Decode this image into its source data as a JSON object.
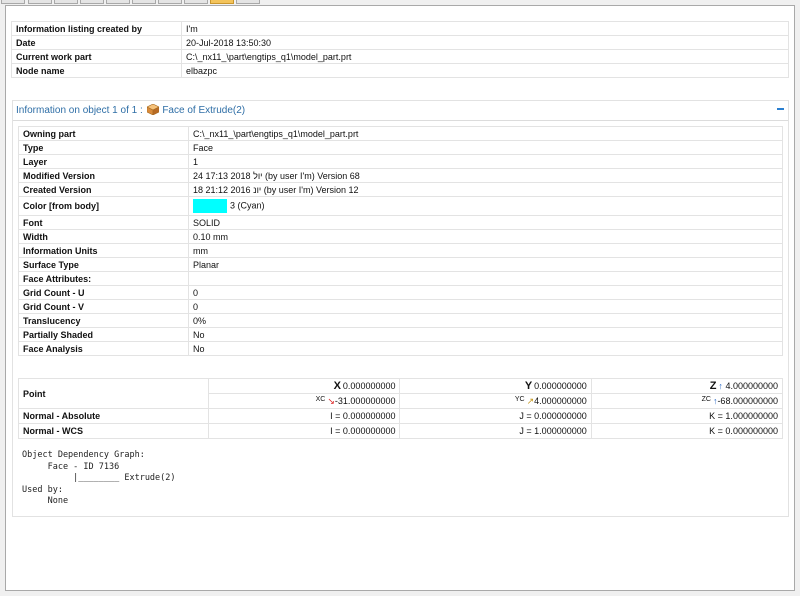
{
  "header": {
    "rows": [
      {
        "label": "Information listing created by",
        "value": "I'm"
      },
      {
        "label": "Date",
        "value": "20-Jul-2018 13:50:30"
      },
      {
        "label": "Current work part",
        "value": "C:\\_nx11_\\part\\engtips_q1\\model_part.prt"
      },
      {
        "label": "Node name",
        "value": "elbazpc"
      }
    ]
  },
  "section": {
    "title_prefix": "Information on object 1 of 1 :",
    "title_object": "Face of Extrude(2)",
    "collapse_icon": "minus-icon"
  },
  "properties": [
    {
      "label": "Owning part",
      "value": "C:\\_nx11_\\part\\engtips_q1\\model_part.prt"
    },
    {
      "label": "Type",
      "value": "Face"
    },
    {
      "label": "Layer",
      "value": "1"
    },
    {
      "label": "Modified Version",
      "value": "24 17:13 2018 יול (by user I'm) Version 68"
    },
    {
      "label": "Created Version",
      "value": "18 21:12 2016 יונ (by user I'm) Version 12"
    },
    {
      "label": "Color [from body]",
      "value": "3 (Cyan)",
      "swatch": "#00ffff"
    },
    {
      "label": "Font",
      "value": "SOLID"
    },
    {
      "label": "Width",
      "value": "0.10 mm"
    },
    {
      "label": "Information Units",
      "value": "mm"
    },
    {
      "label": "Surface Type",
      "value": "Planar"
    },
    {
      "label": "Face Attributes:",
      "value": ""
    },
    {
      "label": "Grid Count - U",
      "value": "0"
    },
    {
      "label": "Grid Count - V",
      "value": "0"
    },
    {
      "label": "Translucency",
      "value": "0%"
    },
    {
      "label": "Partially Shaded",
      "value": "No"
    },
    {
      "label": "Face Analysis",
      "value": "No"
    }
  ],
  "geometry": {
    "point_label": "Point",
    "point_abs": {
      "x": {
        "axis": "X",
        "value": "0.000000000"
      },
      "y": {
        "axis": "Y",
        "value": "0.000000000"
      },
      "z": {
        "axis": "Z",
        "value": "4.000000000"
      }
    },
    "point_wcs": {
      "x": {
        "axis": "XC",
        "value": "-31.000000000"
      },
      "y": {
        "axis": "YC",
        "value": "4.000000000"
      },
      "z": {
        "axis": "ZC",
        "value": "-68.000000000"
      }
    },
    "normal_abs": {
      "label": "Normal - Absolute",
      "i": "I = 0.000000000",
      "j": "J = 0.000000000",
      "k": "K = 1.000000000"
    },
    "normal_wcs": {
      "label": "Normal - WCS",
      "i": "I = 0.000000000",
      "j": "J = 1.000000000",
      "k": "K = 0.000000000"
    }
  },
  "dependency_text": "Object Dependency Graph:\n     Face - ID 7136\n          |________ Extrude(2)\nUsed by:\n     None"
}
